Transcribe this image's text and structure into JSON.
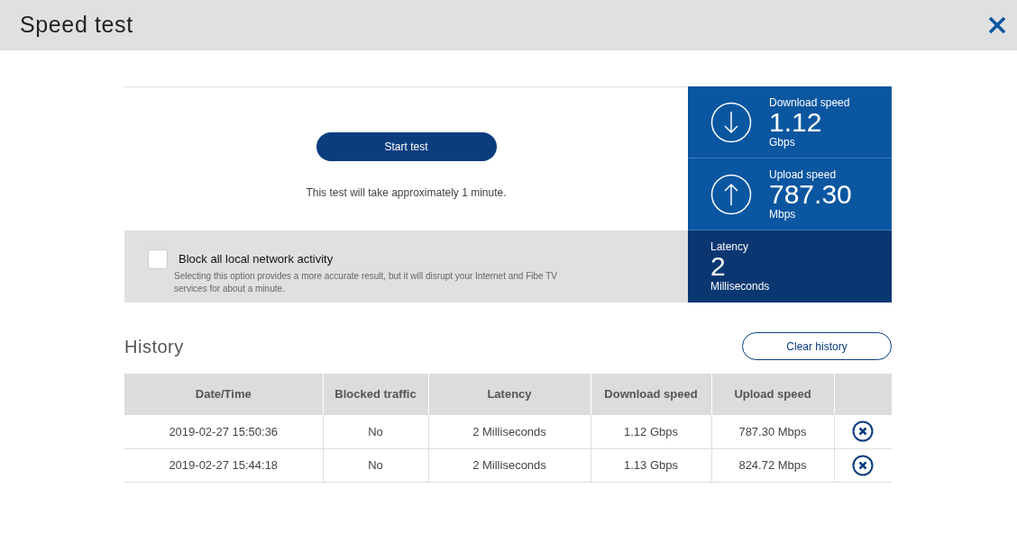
{
  "window": {
    "title": "Speed test"
  },
  "test": {
    "button": "Start test",
    "note": "This test will take approximately 1 minute."
  },
  "block_option": {
    "label": "Block all local network activity",
    "checked": false,
    "description": "Selecting this option provides a more accurate result, but it will disrupt your Internet and Fibe TV services for about a minute."
  },
  "metrics": [
    {
      "kind": "download",
      "label": "Download speed",
      "value": "1.12",
      "unit": "Gbps"
    },
    {
      "kind": "upload",
      "label": "Upload speed",
      "value": "787.30",
      "unit": "Mbps"
    },
    {
      "kind": "latency",
      "label": "Latency",
      "value": "2",
      "unit": "Milliseconds"
    }
  ],
  "history": {
    "title": "History",
    "clear_button": "Clear history",
    "columns": [
      "Date/Time",
      "Blocked traffic",
      "Latency",
      "Download speed",
      "Upload speed"
    ],
    "rows": [
      [
        "2019-02-27 15:50:36",
        "No",
        "2 Milliseconds",
        "1.12 Gbps",
        "787.30 Mbps"
      ],
      [
        "2019-02-27 15:44:18",
        "No",
        "2 Milliseconds",
        "1.13 Gbps",
        "824.72 Mbps"
      ]
    ]
  }
}
